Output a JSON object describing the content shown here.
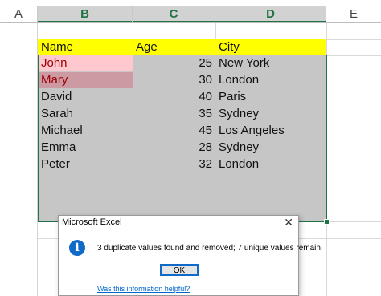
{
  "columns": [
    "A",
    "B",
    "C",
    "D",
    "E"
  ],
  "headers": {
    "name": "Name",
    "age": "Age",
    "city": "City"
  },
  "rows": [
    {
      "name": "John",
      "age": "25",
      "city": "New York"
    },
    {
      "name": "Mary",
      "age": "30",
      "city": "London"
    },
    {
      "name": "David",
      "age": "40",
      "city": "Paris"
    },
    {
      "name": "Sarah",
      "age": "35",
      "city": "Sydney"
    },
    {
      "name": "Michael",
      "age": "45",
      "city": "Los Angeles"
    },
    {
      "name": "Emma",
      "age": "28",
      "city": "Sydney"
    },
    {
      "name": "Peter",
      "age": "32",
      "city": "London"
    }
  ],
  "dialog": {
    "title": "Microsoft Excel",
    "close": "✕",
    "icon": "i",
    "message": "3 duplicate values found and removed; 7 unique values remain.",
    "ok": "OK",
    "help_link": "Was this information helpful?"
  },
  "colors": {
    "header_fill": "#ffff00",
    "selection_fill": "#c6c6c6",
    "duplicate_fill": "#ffc7ce",
    "duplicate_text": "#9c0006",
    "excel_green": "#217346",
    "info_blue": "#0f6bc7"
  }
}
